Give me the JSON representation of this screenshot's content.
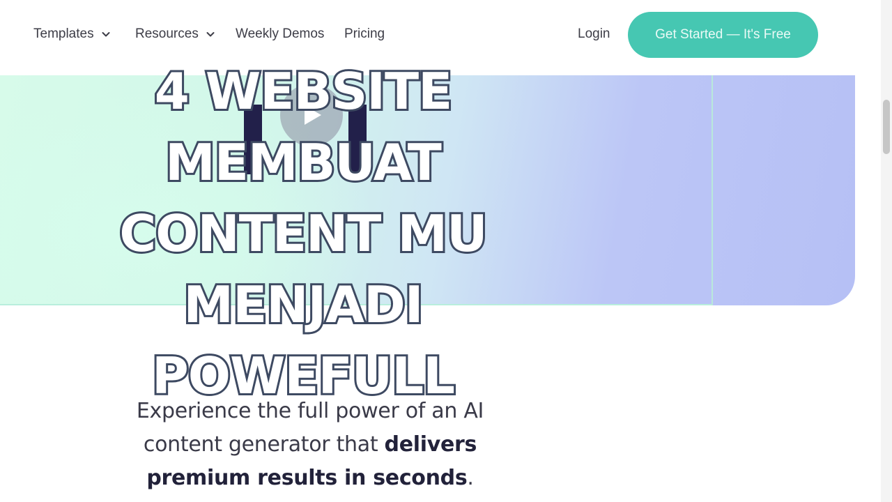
{
  "nav": {
    "items": [
      {
        "label": "Templates",
        "has_dropdown": true
      },
      {
        "label": "Resources",
        "has_dropdown": true
      },
      {
        "label": "Weekly Demos",
        "has_dropdown": false
      },
      {
        "label": "Pricing",
        "has_dropdown": false
      }
    ],
    "login_label": "Login",
    "cta_label": "Get Started — It's Free"
  },
  "overlay": {
    "headline_lines": [
      "4 WEBSITE",
      "MEMBUAT",
      "CONTENT MU",
      "MENJADI",
      "POWEFULL"
    ]
  },
  "tagline": {
    "line1": "Experience the full power of an AI",
    "line2_regular": "content generator that ",
    "line2_bold": "delivers",
    "line3_bold": "premium results in seconds",
    "line3_end": "."
  },
  "icons": {
    "dropdown": "chevron-down-icon",
    "video": "play-icon"
  },
  "colors": {
    "cta_bg": "#46c7b2",
    "nav_text": "#3d3d47",
    "headline_fill": "#ffffff",
    "headline_stroke": "#3e4a62",
    "hero_left": "#d7fbea",
    "hero_right": "#b6c0f5"
  }
}
